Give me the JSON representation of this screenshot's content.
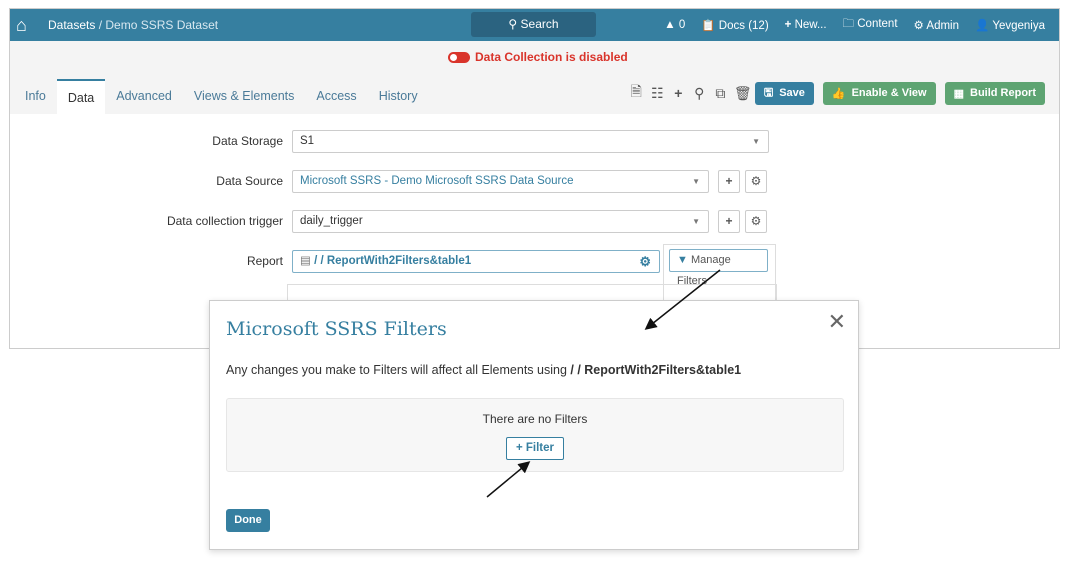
{
  "header": {
    "breadcrumb_root": "Datasets",
    "breadcrumb_current": " / Demo SSRS Dataset",
    "search": "Search",
    "alerts": "0",
    "docs": "Docs (12)",
    "new": "New...",
    "content": "Content",
    "admin": "Admin",
    "user": "Yevgeniya"
  },
  "status": {
    "data_collection": "Data Collection is disabled"
  },
  "tabs": [
    "Info",
    "Data",
    "Advanced",
    "Views & Elements",
    "Access",
    "History"
  ],
  "toolbar": {
    "save": "Save",
    "enable_view": "Enable & View",
    "build_report": "Build Report"
  },
  "form": {
    "storage_label": "Data Storage",
    "storage_value": "S1",
    "source_label": "Data Source",
    "source_value": "Microsoft SSRS - Demo Microsoft SSRS Data Source",
    "trigger_label": "Data collection trigger",
    "trigger_value": "daily_trigger",
    "report_label": "Report",
    "report_value": "/ / ReportWith2Filters&table1",
    "manage_filters": "Manage Filters"
  },
  "modal": {
    "title": "Microsoft SSRS Filters",
    "message": "Any changes you make to Filters will affect all Elements using ",
    "message_bold": "/ / ReportWith2Filters&table1",
    "empty": "There are no Filters",
    "add_filter": "Filter",
    "done": "Done"
  }
}
